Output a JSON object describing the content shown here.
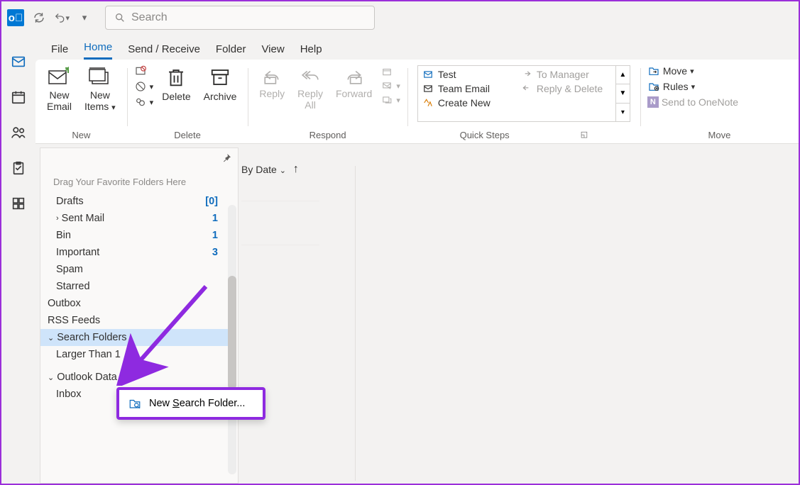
{
  "title_icons": {
    "search_placeholder": "Search"
  },
  "menubar": {
    "file": "File",
    "home": "Home",
    "sendreceive": "Send / Receive",
    "folder": "Folder",
    "view": "View",
    "help": "Help"
  },
  "ribbon": {
    "new": {
      "label": "New",
      "new_email": "New\nEmail",
      "new_items": "New\nItems"
    },
    "delete": {
      "label": "Delete",
      "delete": "Delete",
      "archive": "Archive"
    },
    "respond": {
      "label": "Respond",
      "reply": "Reply",
      "reply_all": "Reply\nAll",
      "forward": "Forward"
    },
    "quicksteps": {
      "label": "Quick Steps",
      "items_left": [
        "Test",
        "Team Email",
        "Create New"
      ],
      "items_right": [
        "To Manager",
        "Reply & Delete"
      ]
    },
    "move": {
      "label": "Move",
      "move": "Move",
      "rules": "Rules",
      "onenote": "Send to OneNote"
    }
  },
  "folderpane": {
    "fav_hint": "Drag Your Favorite Folders Here",
    "rows": [
      {
        "label": "Drafts",
        "count": "[0]",
        "indent": 1
      },
      {
        "label": "Sent Mail",
        "count": "1",
        "indent": 1,
        "expander": ">"
      },
      {
        "label": "Bin",
        "count": "1",
        "indent": 1
      },
      {
        "label": "Important",
        "count": "3",
        "indent": 1
      },
      {
        "label": "Spam",
        "indent": 1
      },
      {
        "label": "Starred",
        "indent": 1
      },
      {
        "label": "Outbox",
        "indent": 0
      },
      {
        "label": "RSS Feeds",
        "indent": 0
      },
      {
        "label": "Search Folders",
        "indent": 0,
        "expander": "v",
        "selected": true
      },
      {
        "label": "Larger Than 1",
        "indent": 1
      },
      {
        "label": "",
        "indent": 0
      },
      {
        "label": "Outlook Data File",
        "indent": 0,
        "expander": "v"
      },
      {
        "label": "Inbox",
        "indent": 1
      }
    ]
  },
  "sort": {
    "by": "By Date"
  },
  "context_menu": {
    "item": "New Search Folder..."
  }
}
